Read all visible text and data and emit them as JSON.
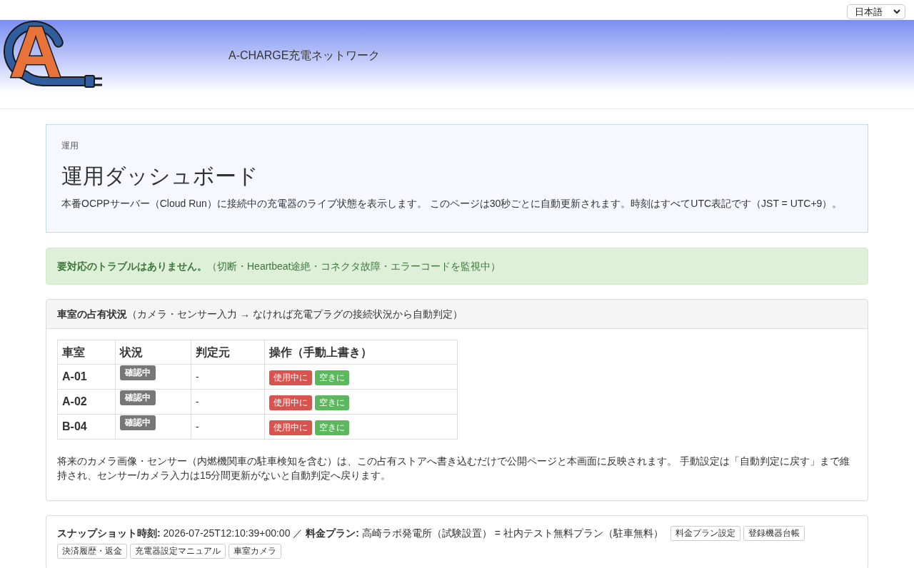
{
  "language_select": {
    "value": "日本語"
  },
  "header": {
    "logo_letter": "A",
    "site_title": "A-CHARGE充電ネットワーク"
  },
  "intro": {
    "breadcrumb": "運用",
    "title": "運用ダッシュボード",
    "description": "本番OCPPサーバー（Cloud Run）に接続中の充電器のライブ状態を表示します。 このページは30秒ごとに自動更新されます。時刻はすべてUTC表記です（JST = UTC+9）。"
  },
  "alert": {
    "text": "**要対応のトラブルはありません。**（切断・Heartbeat途絶・コネクタ故障・エラーコードを監視中）"
  },
  "occupancy": {
    "heading": "**車室の占有状況**（カメラ・センサー入力 → なければ充電プラグの接続状況から自動判定）",
    "table": {
      "columns": [
        "車室",
        "状況",
        "判定元",
        "操作（手動上書き）"
      ],
      "rows": [
        {
          "bay": "A-01",
          "status": {
            "label": "確認中",
            "kind": "pending"
          },
          "source": "-",
          "actions": [
            {
              "label": "使用中に",
              "kind": "set_occupied"
            },
            {
              "label": "空きに",
              "kind": "set_vacant"
            }
          ]
        },
        {
          "bay": "A-02",
          "status": {
            "label": "確認中",
            "kind": "pending"
          },
          "source": "-",
          "actions": [
            {
              "label": "使用中に",
              "kind": "set_occupied"
            },
            {
              "label": "空きに",
              "kind": "set_vacant"
            }
          ]
        },
        {
          "bay": "B-04",
          "status": {
            "label": "確認中",
            "kind": "pending"
          },
          "source": "-",
          "actions": [
            {
              "label": "使用中に",
              "kind": "set_occupied"
            },
            {
              "label": "空きに",
              "kind": "set_vacant"
            }
          ]
        }
      ]
    },
    "note": "将来のカメラ画像・センサー（内燃機関車の駐車検知を含む）は、この占有ストアへ書き込むだけで公開ページと本画面に反映されます。 手動設定は「自動判定に戻す」まで維持され、センサー/カメラ入力は15分間更新がないと自動判定へ戻ります。"
  },
  "snapshot": {
    "text": "**スナップショット時刻:** 2026-07-25T12:10:39+00:00 ／ **料金プラン:** 高崎ラボ発電所（試験設置） = 社内テスト無料プラン（駐車無料）",
    "links": [
      "料金プラン設定",
      "登録機器台帳",
      "決済履歴・返金",
      "充電器設定マニュアル",
      "車室カメラ"
    ]
  }
}
